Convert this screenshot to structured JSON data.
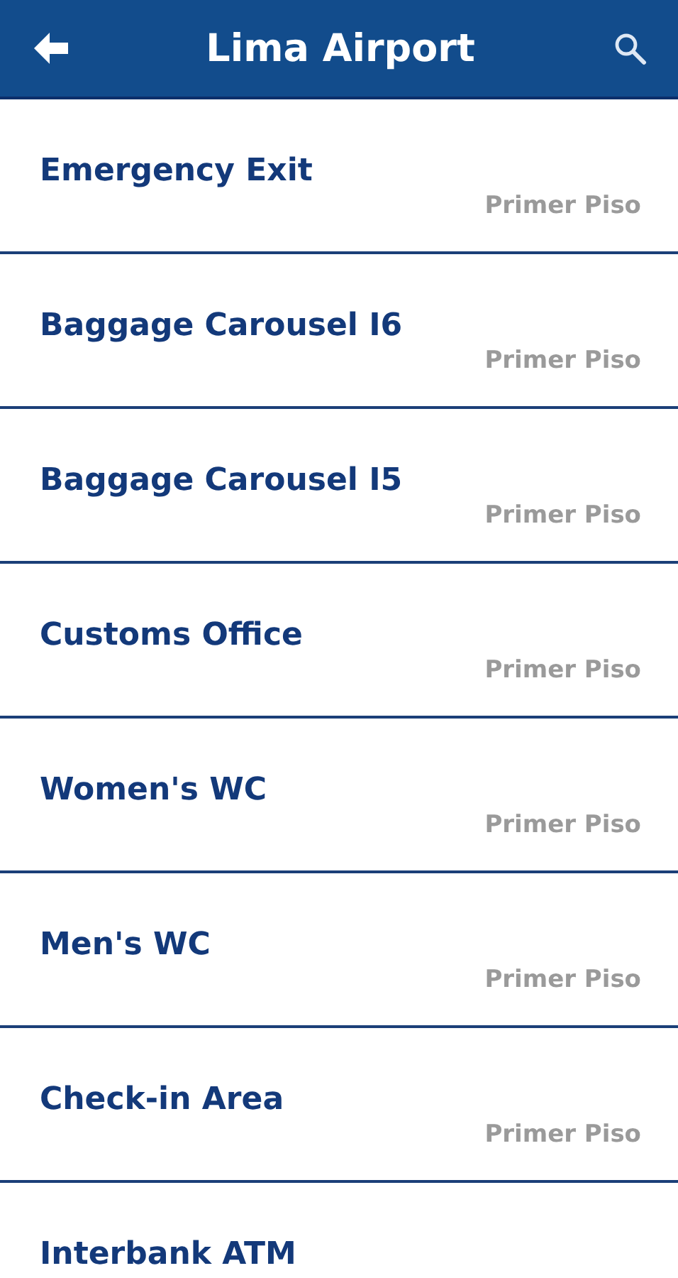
{
  "header": {
    "title": "Lima Airport"
  },
  "places": [
    {
      "name": "Emergency Exit",
      "floor": "Primer Piso"
    },
    {
      "name": "Baggage Carousel I6",
      "floor": "Primer Piso"
    },
    {
      "name": "Baggage Carousel I5",
      "floor": "Primer Piso"
    },
    {
      "name": "Customs Office",
      "floor": "Primer Piso"
    },
    {
      "name": "Women's WC",
      "floor": "Primer Piso"
    },
    {
      "name": "Men's WC",
      "floor": "Primer Piso"
    },
    {
      "name": "Check-in Area",
      "floor": "Primer Piso"
    },
    {
      "name": "Interbank ATM"
    }
  ]
}
